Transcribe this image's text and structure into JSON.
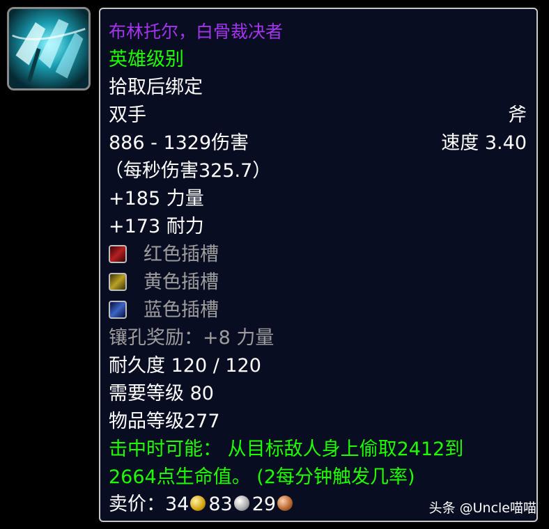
{
  "item": {
    "icon": "axe-item-icon",
    "name": "布林托尔，白骨裁决者",
    "quality": "英雄级别",
    "binding": "拾取后绑定",
    "slot": "双手",
    "type": "斧",
    "damage": "886 - 1329伤害",
    "speed": "速度 3.40",
    "dps": "（每秒伤害325.7）",
    "stats": [
      "+185 力量",
      "+173 耐力"
    ],
    "sockets": [
      {
        "label": "红色插槽",
        "color": "#b52020"
      },
      {
        "label": "黄色插槽",
        "color": "#b9a227"
      },
      {
        "label": "蓝色插槽",
        "color": "#3d64c4"
      }
    ],
    "socket_bonus": "镶孔奖励：+8 力量",
    "durability": "耐久度 120 / 120",
    "required_level": "需要等级 80",
    "item_level": "物品等级277",
    "proc_line1": "击中时可能： 从目标敌人身上偷取2412到",
    "proc_line2": "2664点生命值。 (2每分钟触发几率)",
    "sell_label": "卖价：",
    "sell_gold": "34",
    "sell_silver": "83",
    "sell_copper": "29"
  },
  "watermark": "头条 @Uncle喵喵",
  "colors": {
    "epic": "#a335ee",
    "uncommon": "#1eff00",
    "disabled": "#9d9d9d",
    "tooltip_bg": "#090d22"
  }
}
